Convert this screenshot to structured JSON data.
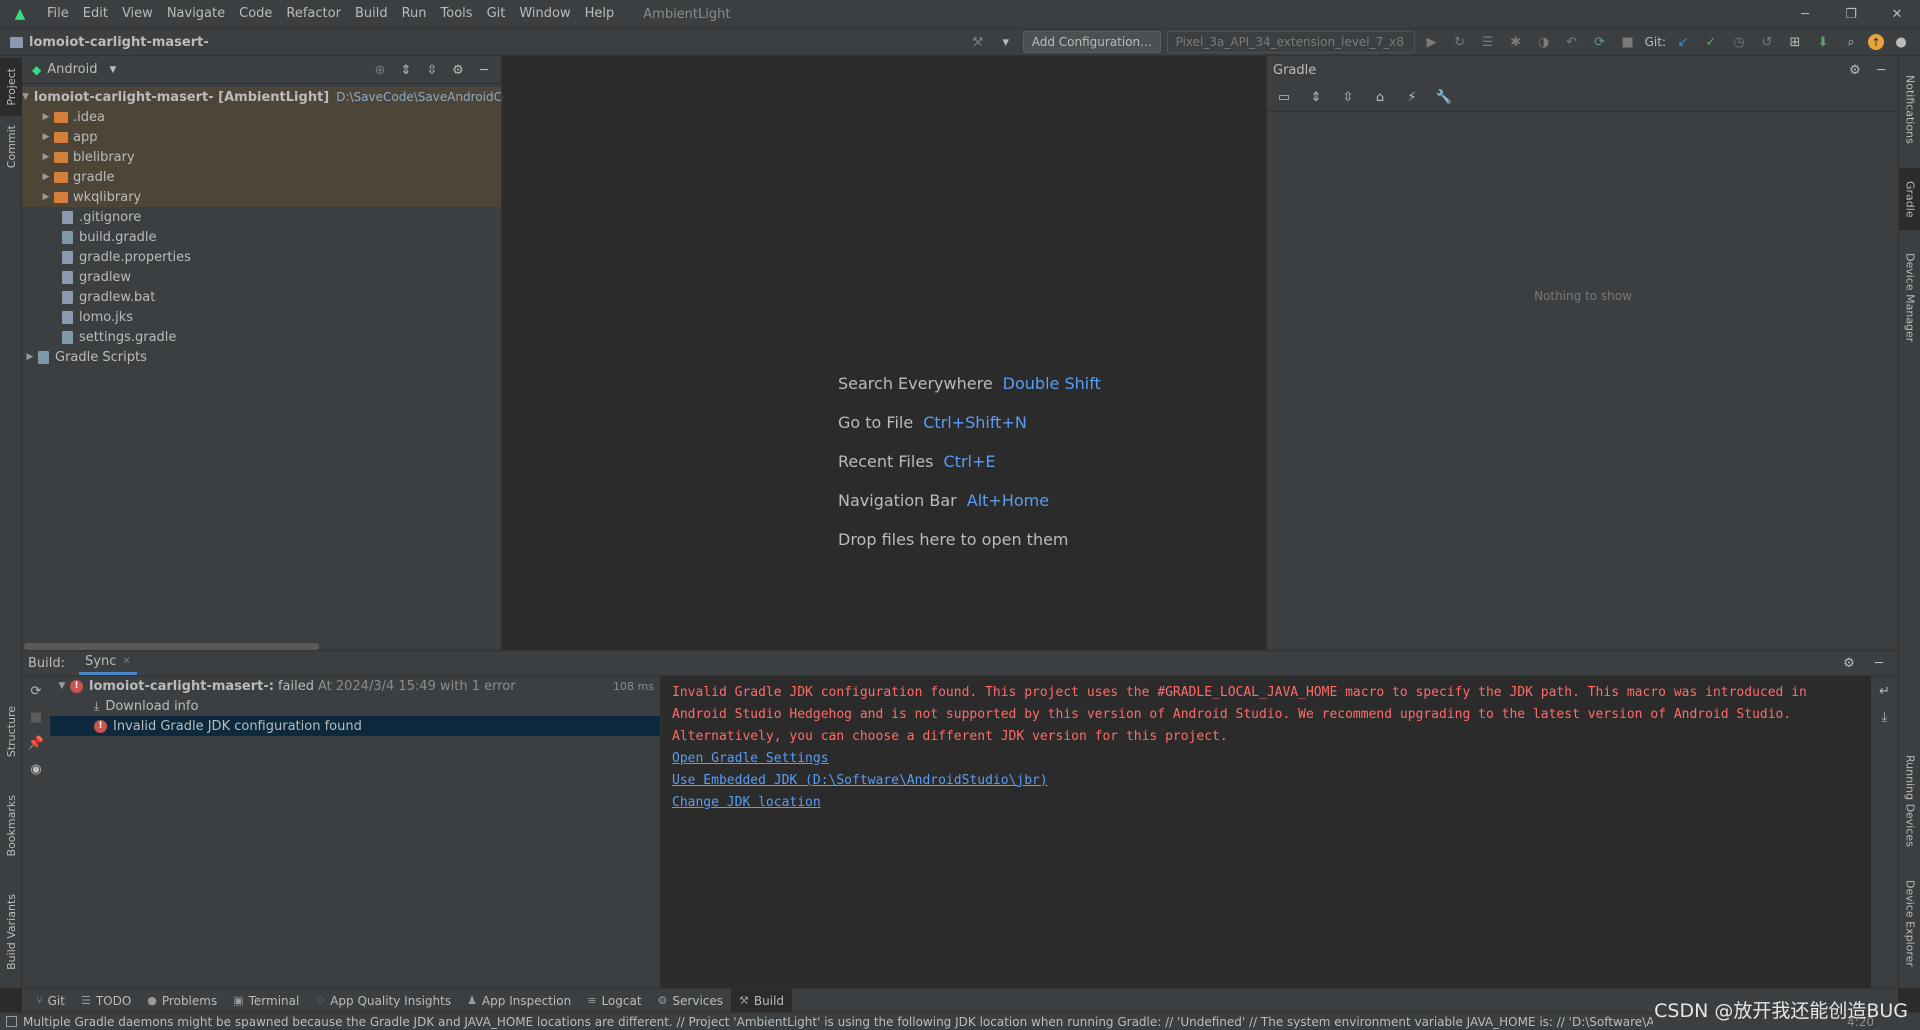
{
  "window": {
    "menu": [
      "File",
      "Edit",
      "View",
      "Navigate",
      "Code",
      "Refactor",
      "Build",
      "Run",
      "Tools",
      "Git",
      "Window",
      "Help"
    ],
    "title": "AmbientLight",
    "controls": [
      "minimize",
      "restore",
      "close"
    ]
  },
  "navbar": {
    "project_crumb": "lomoiot-carlight-masert-",
    "config_button": "Add Configuration...",
    "device": "Pixel_3a_API_34_extension_level_7_x8",
    "git_label": "Git:"
  },
  "left_strip": {
    "tabs": [
      "Project",
      "Commit",
      "Structure",
      "Bookmarks",
      "Build Variants"
    ]
  },
  "right_strip": {
    "tabs": [
      "Notifications",
      "Gradle",
      "Device Manager",
      "Running Devices",
      "Device Explorer"
    ]
  },
  "project_panel": {
    "view_selector": "Android",
    "root": {
      "name": "lomoiot-carlight-masert- [AmbientLight]",
      "path": "D:\\SaveCode\\SaveAndroidCode\\"
    },
    "folders": [
      ".idea",
      "app",
      "blelibrary",
      "gradle",
      "wkqlibrary"
    ],
    "files": [
      ".gitignore",
      "build.gradle",
      "gradle.properties",
      "gradlew",
      "gradlew.bat",
      "lomo.jks",
      "settings.gradle"
    ],
    "gradle_scripts": "Gradle Scripts"
  },
  "editor": {
    "hints": [
      {
        "label": "Search Everywhere",
        "key": "Double Shift"
      },
      {
        "label": "Go to File",
        "key": "Ctrl+Shift+N"
      },
      {
        "label": "Recent Files",
        "key": "Ctrl+E"
      },
      {
        "label": "Navigation Bar",
        "key": "Alt+Home"
      },
      {
        "label": "Drop files here to open them",
        "key": ""
      }
    ]
  },
  "gradle_panel": {
    "title": "Gradle",
    "empty_text": "Nothing to show"
  },
  "build": {
    "label": "Build:",
    "tab": "Sync",
    "tree": {
      "root_name": "lomoiot-carlight-masert-:",
      "root_status": "failed",
      "root_detail": "At 2024/3/4 15:49 with 1 error",
      "root_time": "108 ms",
      "download": "Download info",
      "error": "Invalid Gradle JDK configuration found"
    },
    "output": {
      "error_lines": [
        "Invalid Gradle JDK configuration found. This project uses the #GRADLE_LOCAL_JAVA_HOME macro to specify the JDK path. This macro was introduced in",
        " Android Studio Hedgehog and is not supported by this version of Android Studio. We recommend upgrading to the latest version of Android Studio.",
        " Alternatively, you can choose a different JDK version for this project."
      ],
      "links": [
        "Open Gradle Settings",
        "Use Embedded JDK (D:\\Software\\AndroidStudio\\jbr)",
        "Change JDK location"
      ]
    }
  },
  "bottom_tabs": [
    "Git",
    "TODO",
    "Problems",
    "Terminal",
    "App Quality Insights",
    "App Inspection",
    "Logcat",
    "Services",
    "Build"
  ],
  "status": {
    "message": "Multiple Gradle daemons might be spawned because the Gradle JDK and JAVA_HOME locations are different. // Project 'AmbientLight' is using the following JDK location when running Gradle: // 'Undefined' // The system environment variable JAVA_HOME is: // 'D:\\Software\\AndroidStudio\\jbr'... (a minute ago)",
    "position": "4:20"
  },
  "watermark": "CSDN @放开我还能创造BUG",
  "colors": {
    "background": "#2b2b2b",
    "panel": "#3c3f41",
    "error": "#ff6b68",
    "link": "#589df6",
    "android": "#3ddc84",
    "selection": "#0d293e"
  }
}
